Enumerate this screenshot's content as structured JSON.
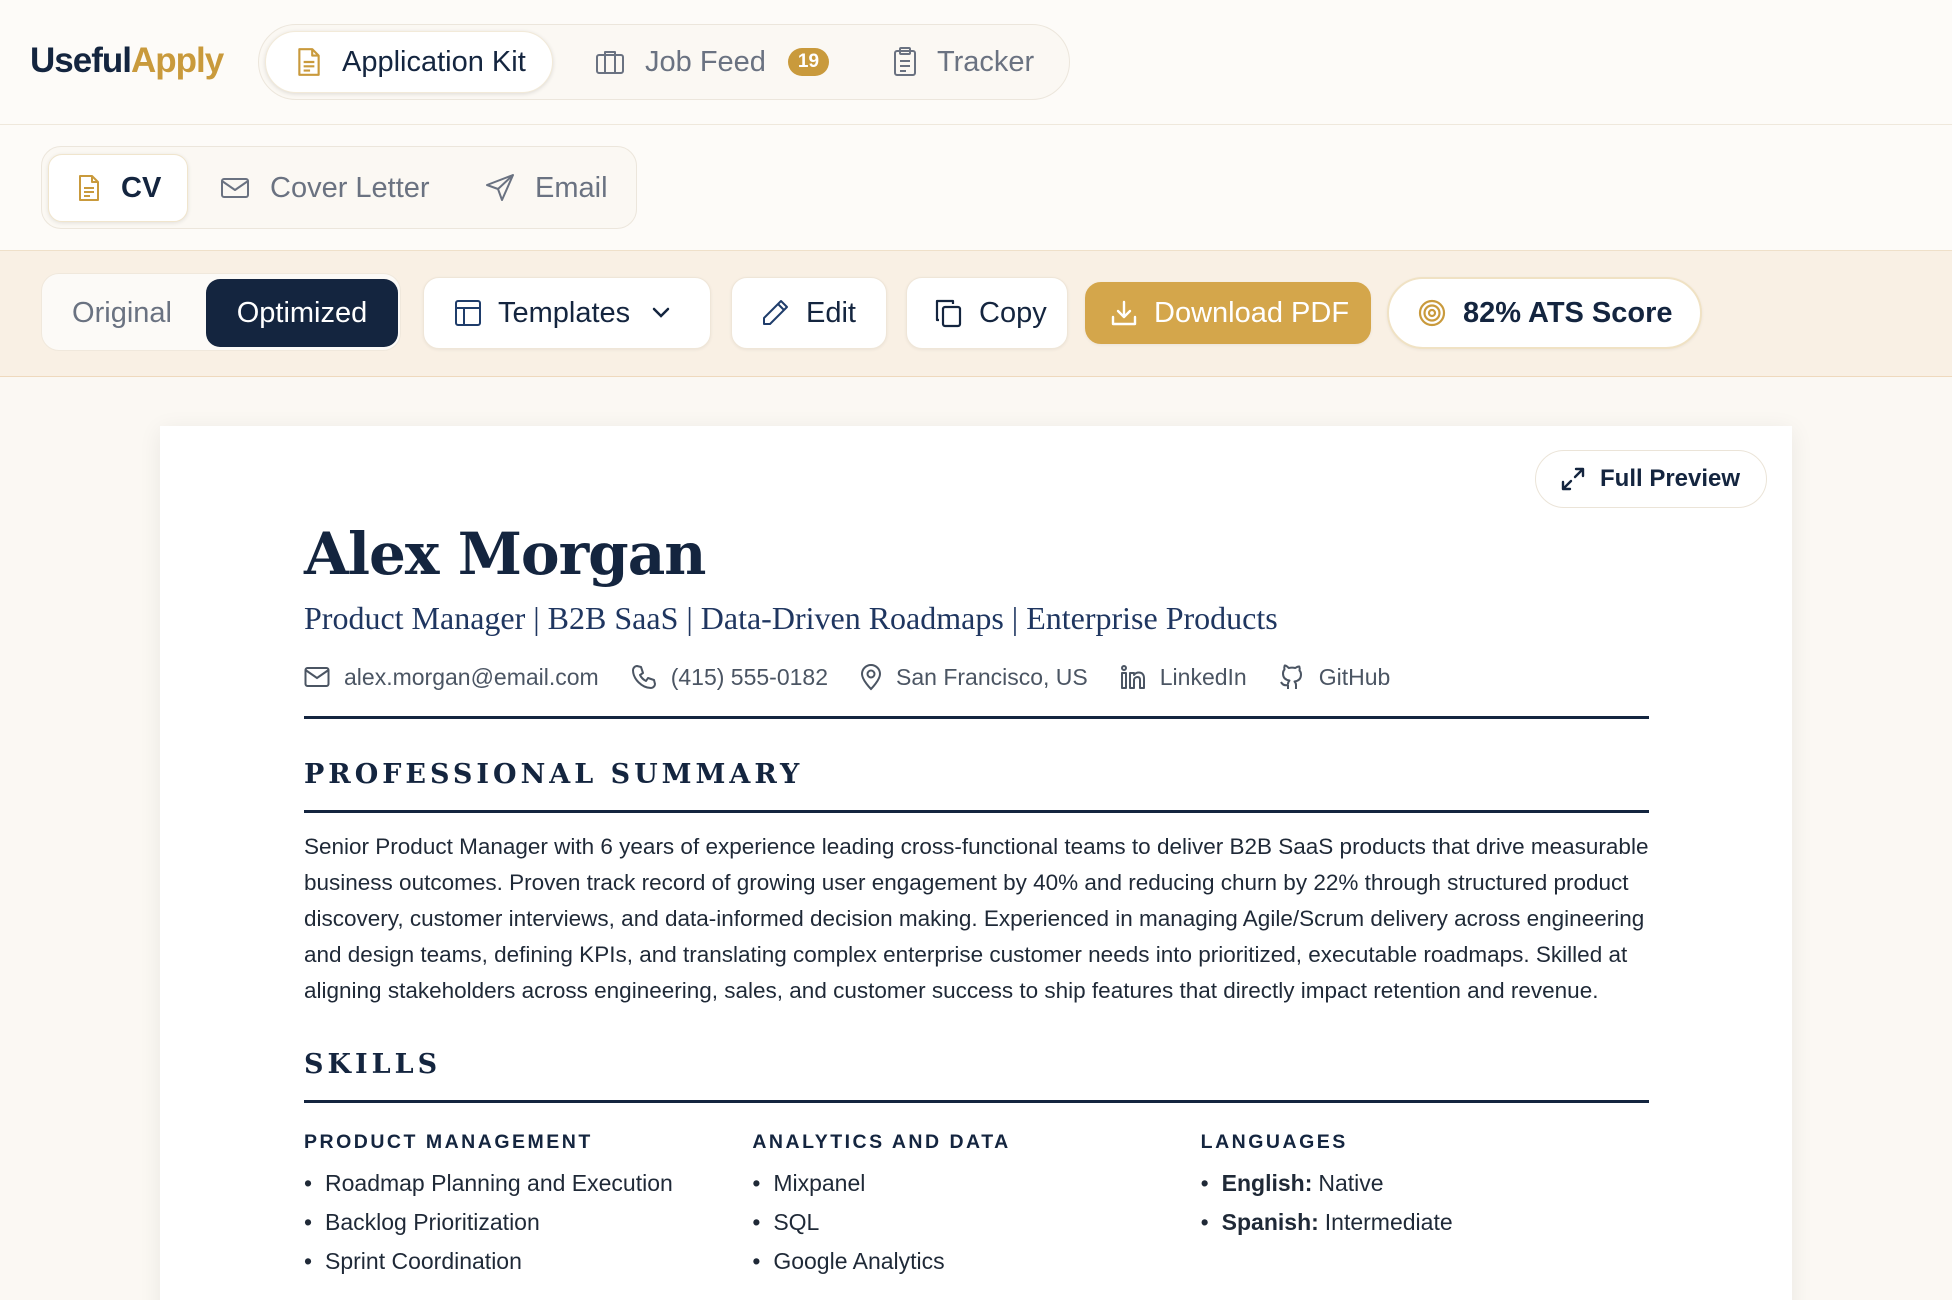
{
  "brand": {
    "part1": "Useful",
    "part2": "Apply"
  },
  "nav": {
    "tabs": [
      {
        "label": "Application Kit",
        "icon": "document-icon",
        "active": true
      },
      {
        "label": "Job Feed",
        "icon": "briefcase-icon",
        "badge": "19"
      },
      {
        "label": "Tracker",
        "icon": "clipboard-icon"
      }
    ]
  },
  "doc_tabs": [
    {
      "label": "CV",
      "icon": "document-icon",
      "active": true
    },
    {
      "label": "Cover Letter",
      "icon": "mail-icon"
    },
    {
      "label": "Email",
      "icon": "send-icon"
    }
  ],
  "toolbar": {
    "toggle": {
      "original": "Original",
      "optimized": "Optimized",
      "selected": "Optimized"
    },
    "templates": "Templates",
    "edit": "Edit",
    "copy": "Copy",
    "download": "Download PDF",
    "ats": "82% ATS Score"
  },
  "preview": {
    "full_preview": "Full Preview"
  },
  "cv": {
    "name": "Alex Morgan",
    "headline": "Product Manager | B2B SaaS | Data-Driven Roadmaps | Enterprise Products",
    "contacts": {
      "email": "alex.morgan@email.com",
      "phone": "(415) 555-0182",
      "location": "San Francisco, US",
      "linkedin": "LinkedIn",
      "github": "GitHub"
    },
    "summary_title": "PROFESSIONAL SUMMARY",
    "summary": "Senior Product Manager with 6 years of experience leading cross-functional teams to deliver B2B SaaS products that drive measurable business outcomes. Proven track record of growing user engagement by 40% and reducing churn by 22% through structured product discovery, customer interviews, and data-informed decision making. Experienced in managing Agile/Scrum delivery across engineering and design teams, defining KPIs, and translating complex enterprise customer needs into prioritized, executable roadmaps. Skilled at aligning stakeholders across engineering, sales, and customer success to ship features that directly impact retention and revenue.",
    "skills_title": "SKILLS",
    "skills": {
      "product": {
        "title": "PRODUCT MANAGEMENT",
        "items": [
          "Roadmap Planning and Execution",
          "Backlog Prioritization",
          "Sprint Coordination"
        ]
      },
      "analytics": {
        "title": "ANALYTICS AND DATA",
        "items": [
          "Mixpanel",
          "SQL",
          "Google Analytics"
        ]
      },
      "languages": {
        "title": "LANGUAGES",
        "items": [
          {
            "lang": "English:",
            "level": "Native"
          },
          {
            "lang": "Spanish:",
            "level": "Intermediate"
          }
        ]
      }
    }
  },
  "colors": {
    "navy": "#14253f",
    "gold": "#c99a3c",
    "download": "#d4a64b"
  }
}
